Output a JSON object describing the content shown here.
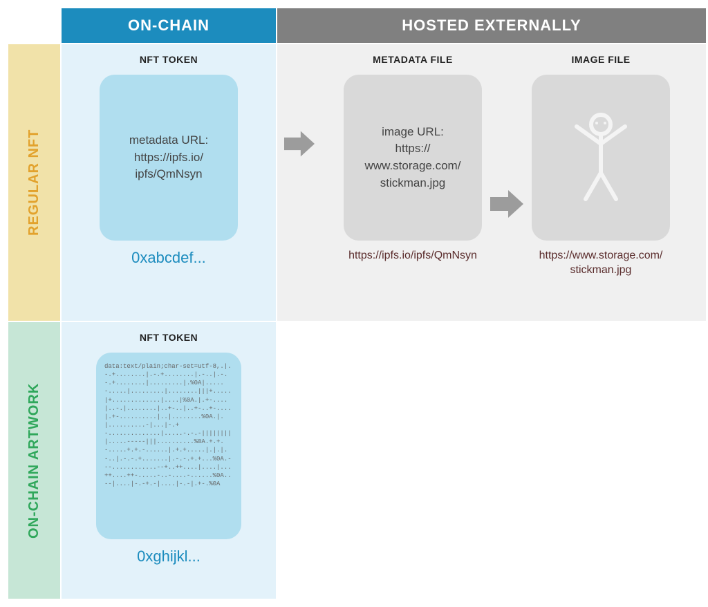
{
  "headers": {
    "onchain": "ON-CHAIN",
    "hosted": "HOSTED EXTERNALLY"
  },
  "rows": {
    "regular": "REGULAR NFT",
    "artwork": "ON-CHAIN ARTWORK"
  },
  "regular": {
    "nft": {
      "title": "NFT TOKEN",
      "label": "metadata URL:",
      "url_line1": "https://ipfs.io/",
      "url_line2": "ipfs/QmNsyn",
      "hash": "0xabcdef..."
    },
    "metadata": {
      "title": "METADATA FILE",
      "label": "image URL:",
      "url_line1": "https://",
      "url_line2": "www.storage.com/",
      "url_line3": "stickman.jpg",
      "caption": "https://ipfs.io/ipfs/QmNsyn"
    },
    "image": {
      "title": "IMAGE FILE",
      "caption_line1": "https://www.storage.com/",
      "caption_line2": "stickman.jpg"
    }
  },
  "artwork": {
    "nft": {
      "title": "NFT TOKEN",
      "data": "data:text/plain;char-set=utf-8,.|.-.+........|.-.+........|.-..|.-.-.+........|.........|.%0A|.....-.....|.........|........|||+.....|+.............|....|%0A.|.+-....|..-.|........|..+-..|..+-..+-....|.+-..........|..|........%0A.|.|..........-|...|-.+-..............|.....-.-.-|||||||||.....-----|||..........%0A.+.+.-.....+.+.-......|.+.+.....|.|.|.-..|.-.-.+.......|.-.-.+.+...%0A.---............--+..++....|....|...++....++-.....-..-....-......%0A..--|....|-.-+.-|....|-.-|.+-.%0A",
      "hash": "0xghijkl..."
    }
  }
}
